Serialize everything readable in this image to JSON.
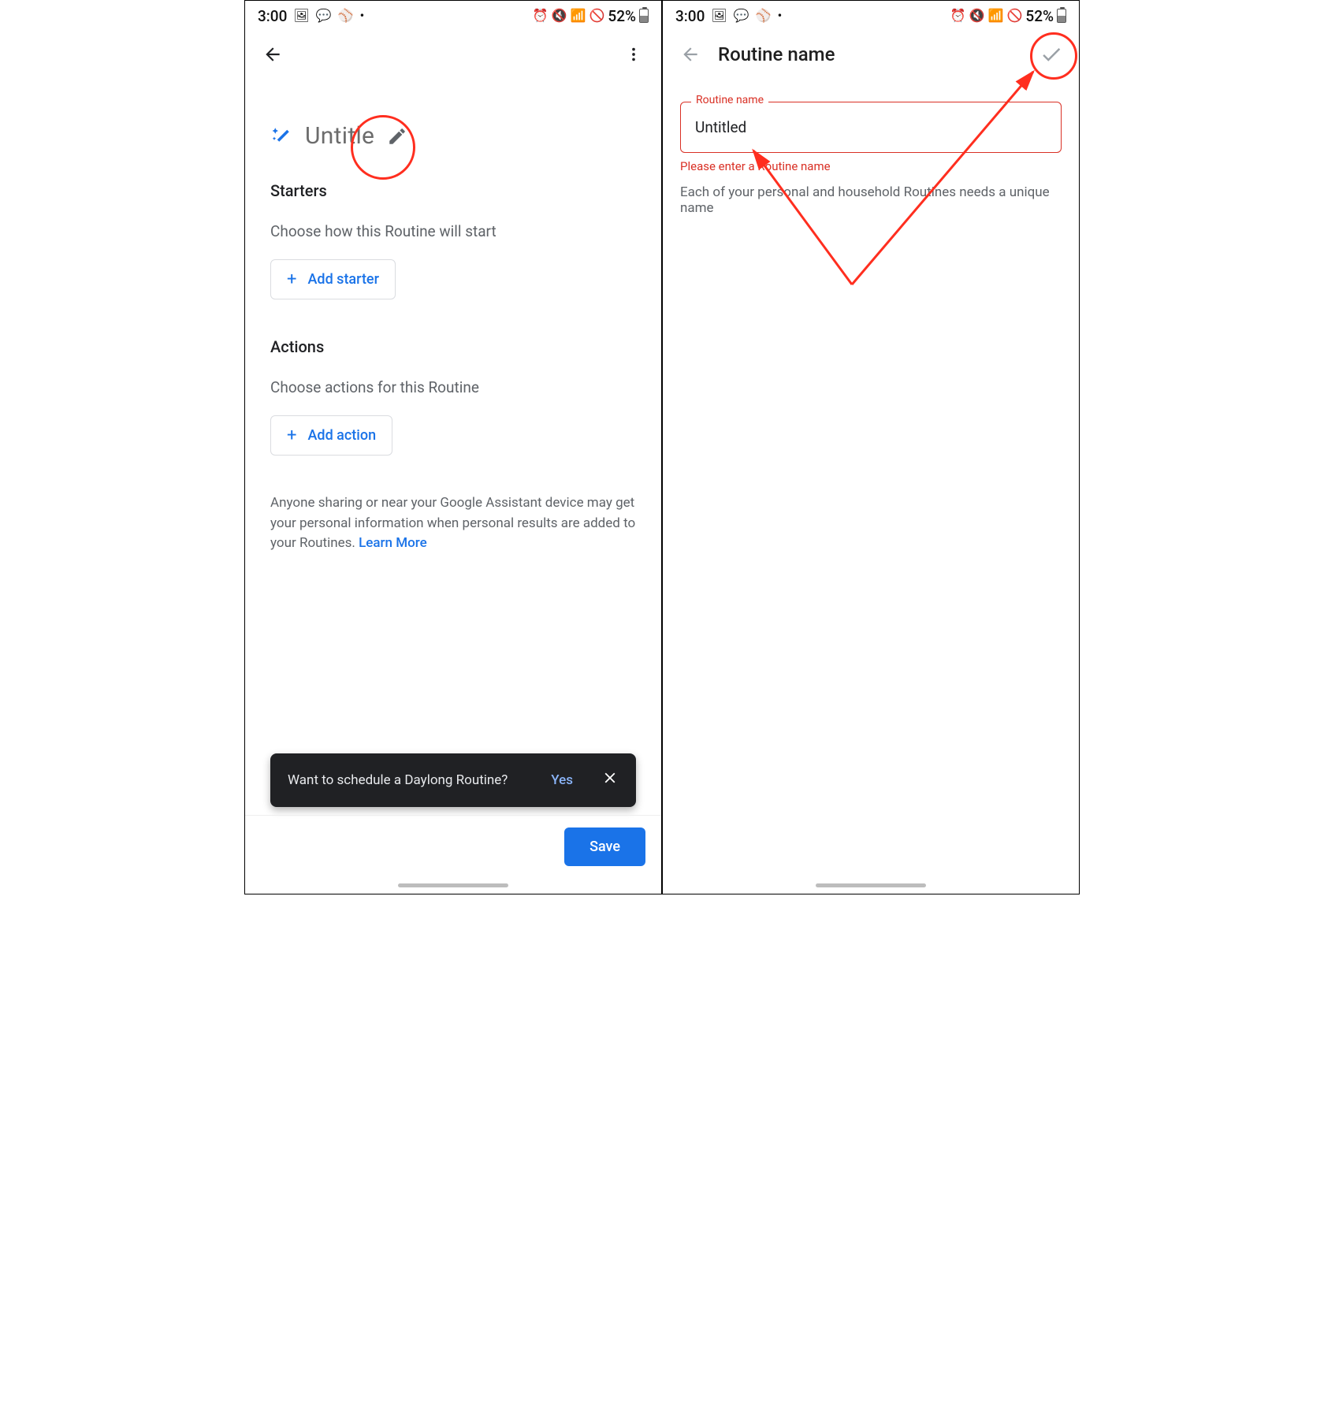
{
  "status": {
    "time": "3:00",
    "battery_text": "52%"
  },
  "left": {
    "routine_title": "Untitle",
    "starters_heading": "Starters",
    "starters_sub": "Choose how this Routine will start",
    "add_starter_label": "Add starter",
    "actions_heading": "Actions",
    "actions_sub": "Choose actions for this Routine",
    "add_action_label": "Add action",
    "info_text": "Anyone sharing or near your Google Assistant device may get your personal information when personal results are added to your Routines. ",
    "learn_more": "Learn More",
    "toast_text": "Want to schedule a Daylong Routine?",
    "toast_yes": "Yes",
    "save_label": "Save"
  },
  "right": {
    "appbar_title": "Routine name",
    "field_label": "Routine name",
    "field_value": "Untitled",
    "error_msg": "Please enter a Routine name",
    "helper_text": "Each of your personal and household Routines needs a unique name"
  }
}
